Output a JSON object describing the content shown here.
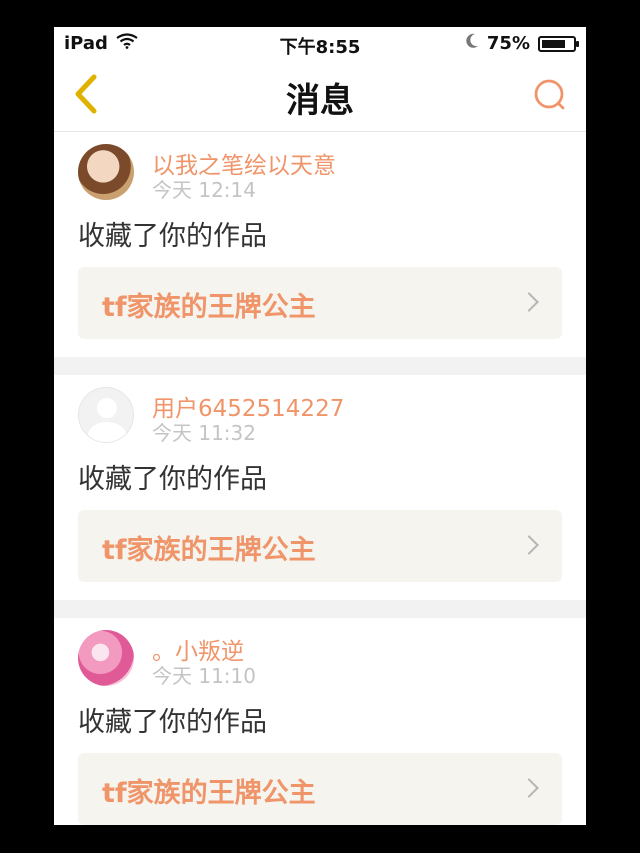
{
  "status_bar": {
    "device": "iPad",
    "time": "下午8:55",
    "battery_percent": "75%",
    "battery_level": 0.75,
    "icons": [
      "wifi-icon",
      "moon-icon",
      "battery-icon"
    ]
  },
  "nav": {
    "title": "消息",
    "icons": [
      "back-chevron-icon",
      "search-icon"
    ],
    "accent_back": "#e0b200",
    "accent_search": "#f0956a"
  },
  "messages": [
    {
      "username": "以我之笔绘以天意",
      "time": "今天 12:14",
      "action": "收藏了你的作品",
      "work_title": "tf家族的王牌公主"
    },
    {
      "username": "用户6452514227",
      "time": "今天 11:32",
      "action": "收藏了你的作品",
      "work_title": "tf家族的王牌公主"
    },
    {
      "username": "。小叛逆",
      "time": "今天 11:10",
      "action": "收藏了你的作品",
      "work_title": "tf家族的王牌公主"
    }
  ],
  "colors": {
    "username": "#f0956a",
    "work_title": "#f0956a",
    "timestamp": "#c4c4c4",
    "work_bg": "#f5f4ef"
  }
}
